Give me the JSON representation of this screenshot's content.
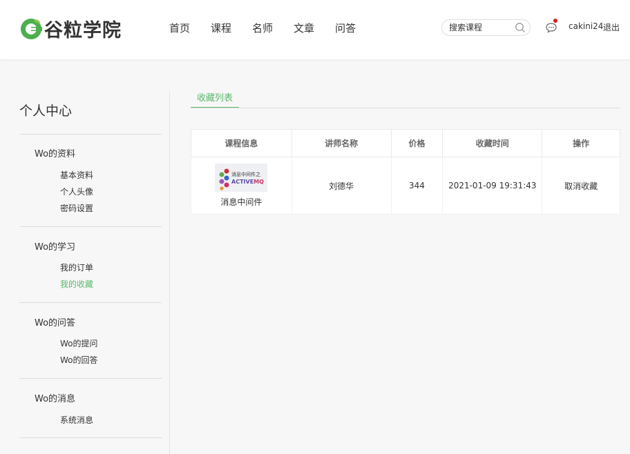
{
  "header": {
    "logo_text": "谷粒学院",
    "nav": [
      "首页",
      "课程",
      "名师",
      "文章",
      "问答"
    ],
    "search_placeholder": "搜索课程",
    "username": "cakini24",
    "logout": "退出"
  },
  "sidebar": {
    "title": "个人中心",
    "groups": [
      {
        "title": "Wo的资料",
        "items": [
          "基本资料",
          "个人头像",
          "密码设置"
        ]
      },
      {
        "title": "Wo的学习",
        "items": [
          "我的订单",
          "我的收藏"
        ]
      },
      {
        "title": "Wo的问答",
        "items": [
          "Wo的提问",
          "Wo的回答"
        ]
      },
      {
        "title": "Wo的消息",
        "items": [
          "系统消息"
        ]
      }
    ],
    "active_item": "我的收藏"
  },
  "main": {
    "tab": "收藏列表",
    "table": {
      "headers": [
        "课程信息",
        "讲师名称",
        "价格",
        "收藏时间",
        "操作"
      ],
      "rows": [
        {
          "image_line1": "消息中间件之",
          "image_line2_a": "ACTIVE",
          "image_line2_b": "MQ",
          "course_name": "消息中间件",
          "teacher": "刘德华",
          "price": "344",
          "time": "2021-01-09 19:31:43",
          "action": "取消收藏"
        }
      ]
    }
  },
  "colors": {
    "accent": "#5ab86c",
    "notice_dot": "#d0211c",
    "logo_green": "#4cae4c"
  }
}
